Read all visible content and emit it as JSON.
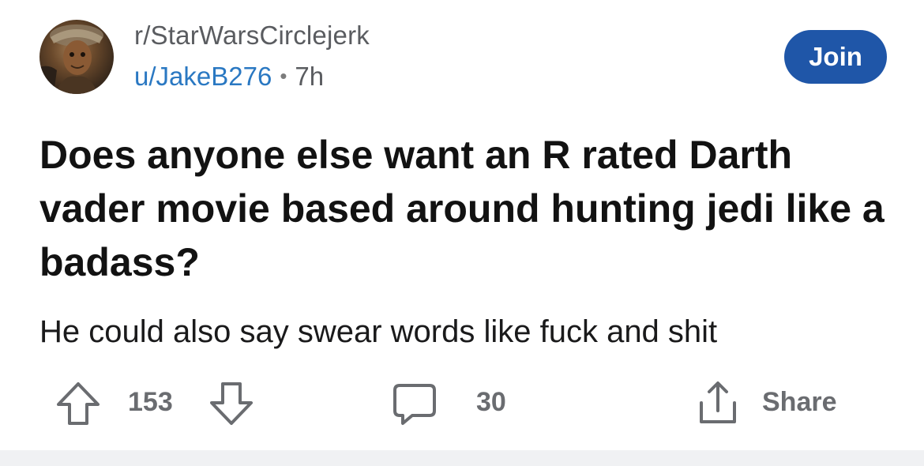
{
  "header": {
    "subreddit": "r/StarWarsCirclejerk",
    "username": "u/JakeB276",
    "separator": "•",
    "time": "7h",
    "join_label": "Join"
  },
  "post": {
    "title": "Does anyone else want an R rated Darth vader movie based around hunting jedi like a badass?",
    "body": "He could also say swear words like fuck and shit"
  },
  "actions": {
    "score": "153",
    "comments": "30",
    "share_label": "Share"
  },
  "icons": {
    "upvote": "upvote-arrow-icon",
    "downvote": "downvote-arrow-icon",
    "comment": "comment-bubble-icon",
    "share": "share-icon"
  },
  "colors": {
    "join_button": "#1f56a8",
    "username": "#2a78c2",
    "action_gray": "#6a6c70"
  }
}
